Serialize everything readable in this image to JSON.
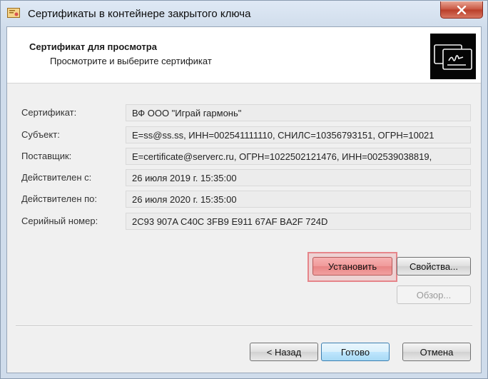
{
  "window": {
    "title": "Сертификаты в контейнере закрытого ключа",
    "close_label": "✕"
  },
  "header": {
    "title": "Сертификат для просмотра",
    "subtitle": "Просмотрите и выберите сертификат"
  },
  "fields": [
    {
      "label": "Сертификат:",
      "value": "ВФ ООО \"Играй гармонь\""
    },
    {
      "label": "Субъект:",
      "value": "E=ss@ss.ss, ИНН=002541111110, СНИЛС=10356793151, ОГРН=10021"
    },
    {
      "label": "Поставщик:",
      "value": "E=certificate@serverc.ru, ОГРН=1022502121476, ИНН=002539038819,"
    },
    {
      "label": "Действителен с:",
      "value": "26 июля 2019 г. 15:35:00"
    },
    {
      "label": "Действителен по:",
      "value": "26 июля 2020 г. 15:35:00"
    },
    {
      "label": "Серийный номер:",
      "value": "2C93 907A C40C 3FB9 E911 67AF BA2F 724D"
    }
  ],
  "buttons": {
    "install": "Установить",
    "properties": "Свойства...",
    "browse": "Обзор...",
    "back": "< Назад",
    "done": "Готово",
    "cancel": "Отмена"
  },
  "colors": {
    "highlight": "#e6858a",
    "close_button": "#c8543f",
    "default_button": "#3c7fb1"
  }
}
